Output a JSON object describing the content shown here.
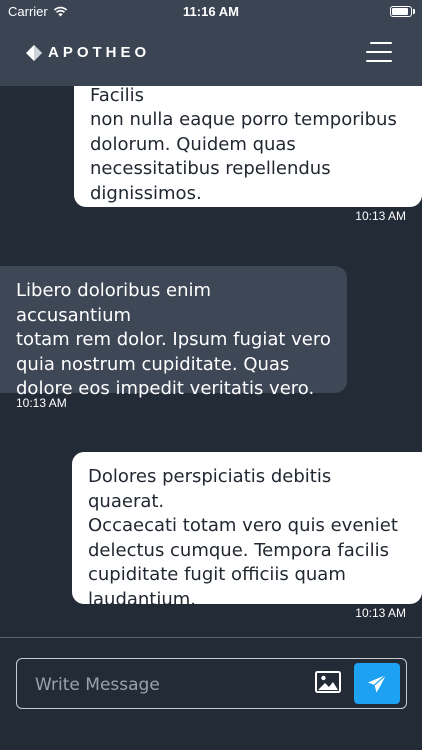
{
  "status_bar": {
    "carrier": "Carrier",
    "time": "11:16 AM",
    "battery_level": 1.0
  },
  "header": {
    "logo_text": "APOTHEO",
    "menu_icon": "hamburger-menu-icon"
  },
  "messages": [
    {
      "direction": "outgoing",
      "lines": [
        "voluptate vel aliquam atque. Facilis",
        "non nulla eaque porro temporibus",
        "dolorum. Quidem quas",
        "necessitatibus repellendus",
        "dignissimos."
      ],
      "time": "10:13 AM"
    },
    {
      "direction": "incoming",
      "lines": [
        "Libero doloribus enim accusantium",
        "totam rem dolor. Ipsum fugiat vero",
        "quia nostrum cupiditate. Quas",
        "dolore eos impedit veritatis vero."
      ],
      "time": "10:13 AM"
    },
    {
      "direction": "outgoing",
      "lines": [
        "Dolores perspiciatis debitis quaerat.",
        "Occaecati totam vero quis eveniet",
        "delectus cumque. Tempora facilis",
        "cupiditate fugit officiis quam",
        "laudantium."
      ],
      "time": "10:13 AM"
    }
  ],
  "composer": {
    "placeholder": "Write Message",
    "value": "",
    "image_icon": "image-icon",
    "send_icon": "send-icon"
  },
  "colors": {
    "background": "#232b36",
    "header": "#3a4452",
    "incoming_bubble": "#3e4756",
    "outgoing_bubble": "#ffffff",
    "accent": "#1da1f2"
  }
}
